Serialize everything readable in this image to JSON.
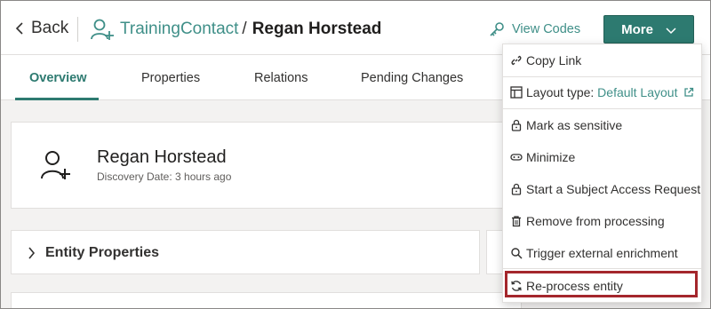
{
  "header": {
    "back_label": "Back",
    "entity_type": "TrainingContact",
    "separator": "/",
    "entity_name": "Regan Horstead",
    "view_codes_label": "View Codes",
    "more_label": "More"
  },
  "tabs": [
    {
      "label": "Overview",
      "active": true
    },
    {
      "label": "Properties",
      "active": false
    },
    {
      "label": "Relations",
      "active": false
    },
    {
      "label": "Pending Changes",
      "active": false
    }
  ],
  "entity_card": {
    "name": "Regan Horstead",
    "meta": "Discovery Date: 3 hours ago"
  },
  "sections": {
    "entity_properties": "Entity Properties"
  },
  "menu": {
    "copy_link": "Copy Link",
    "layout_type_label": "Layout type:",
    "layout_type_value": "Default Layout",
    "mark_sensitive": "Mark as sensitive",
    "minimize": "Minimize",
    "subject_access": "Start a Subject Access Request",
    "remove_processing": "Remove from processing",
    "trigger_enrichment": "Trigger external enrichment",
    "reprocess": "Re-process entity",
    "highlighted_item": "reprocess"
  },
  "colors": {
    "accent": "#2d7a70",
    "link": "#3f8f88",
    "highlight": "#a4262c"
  }
}
